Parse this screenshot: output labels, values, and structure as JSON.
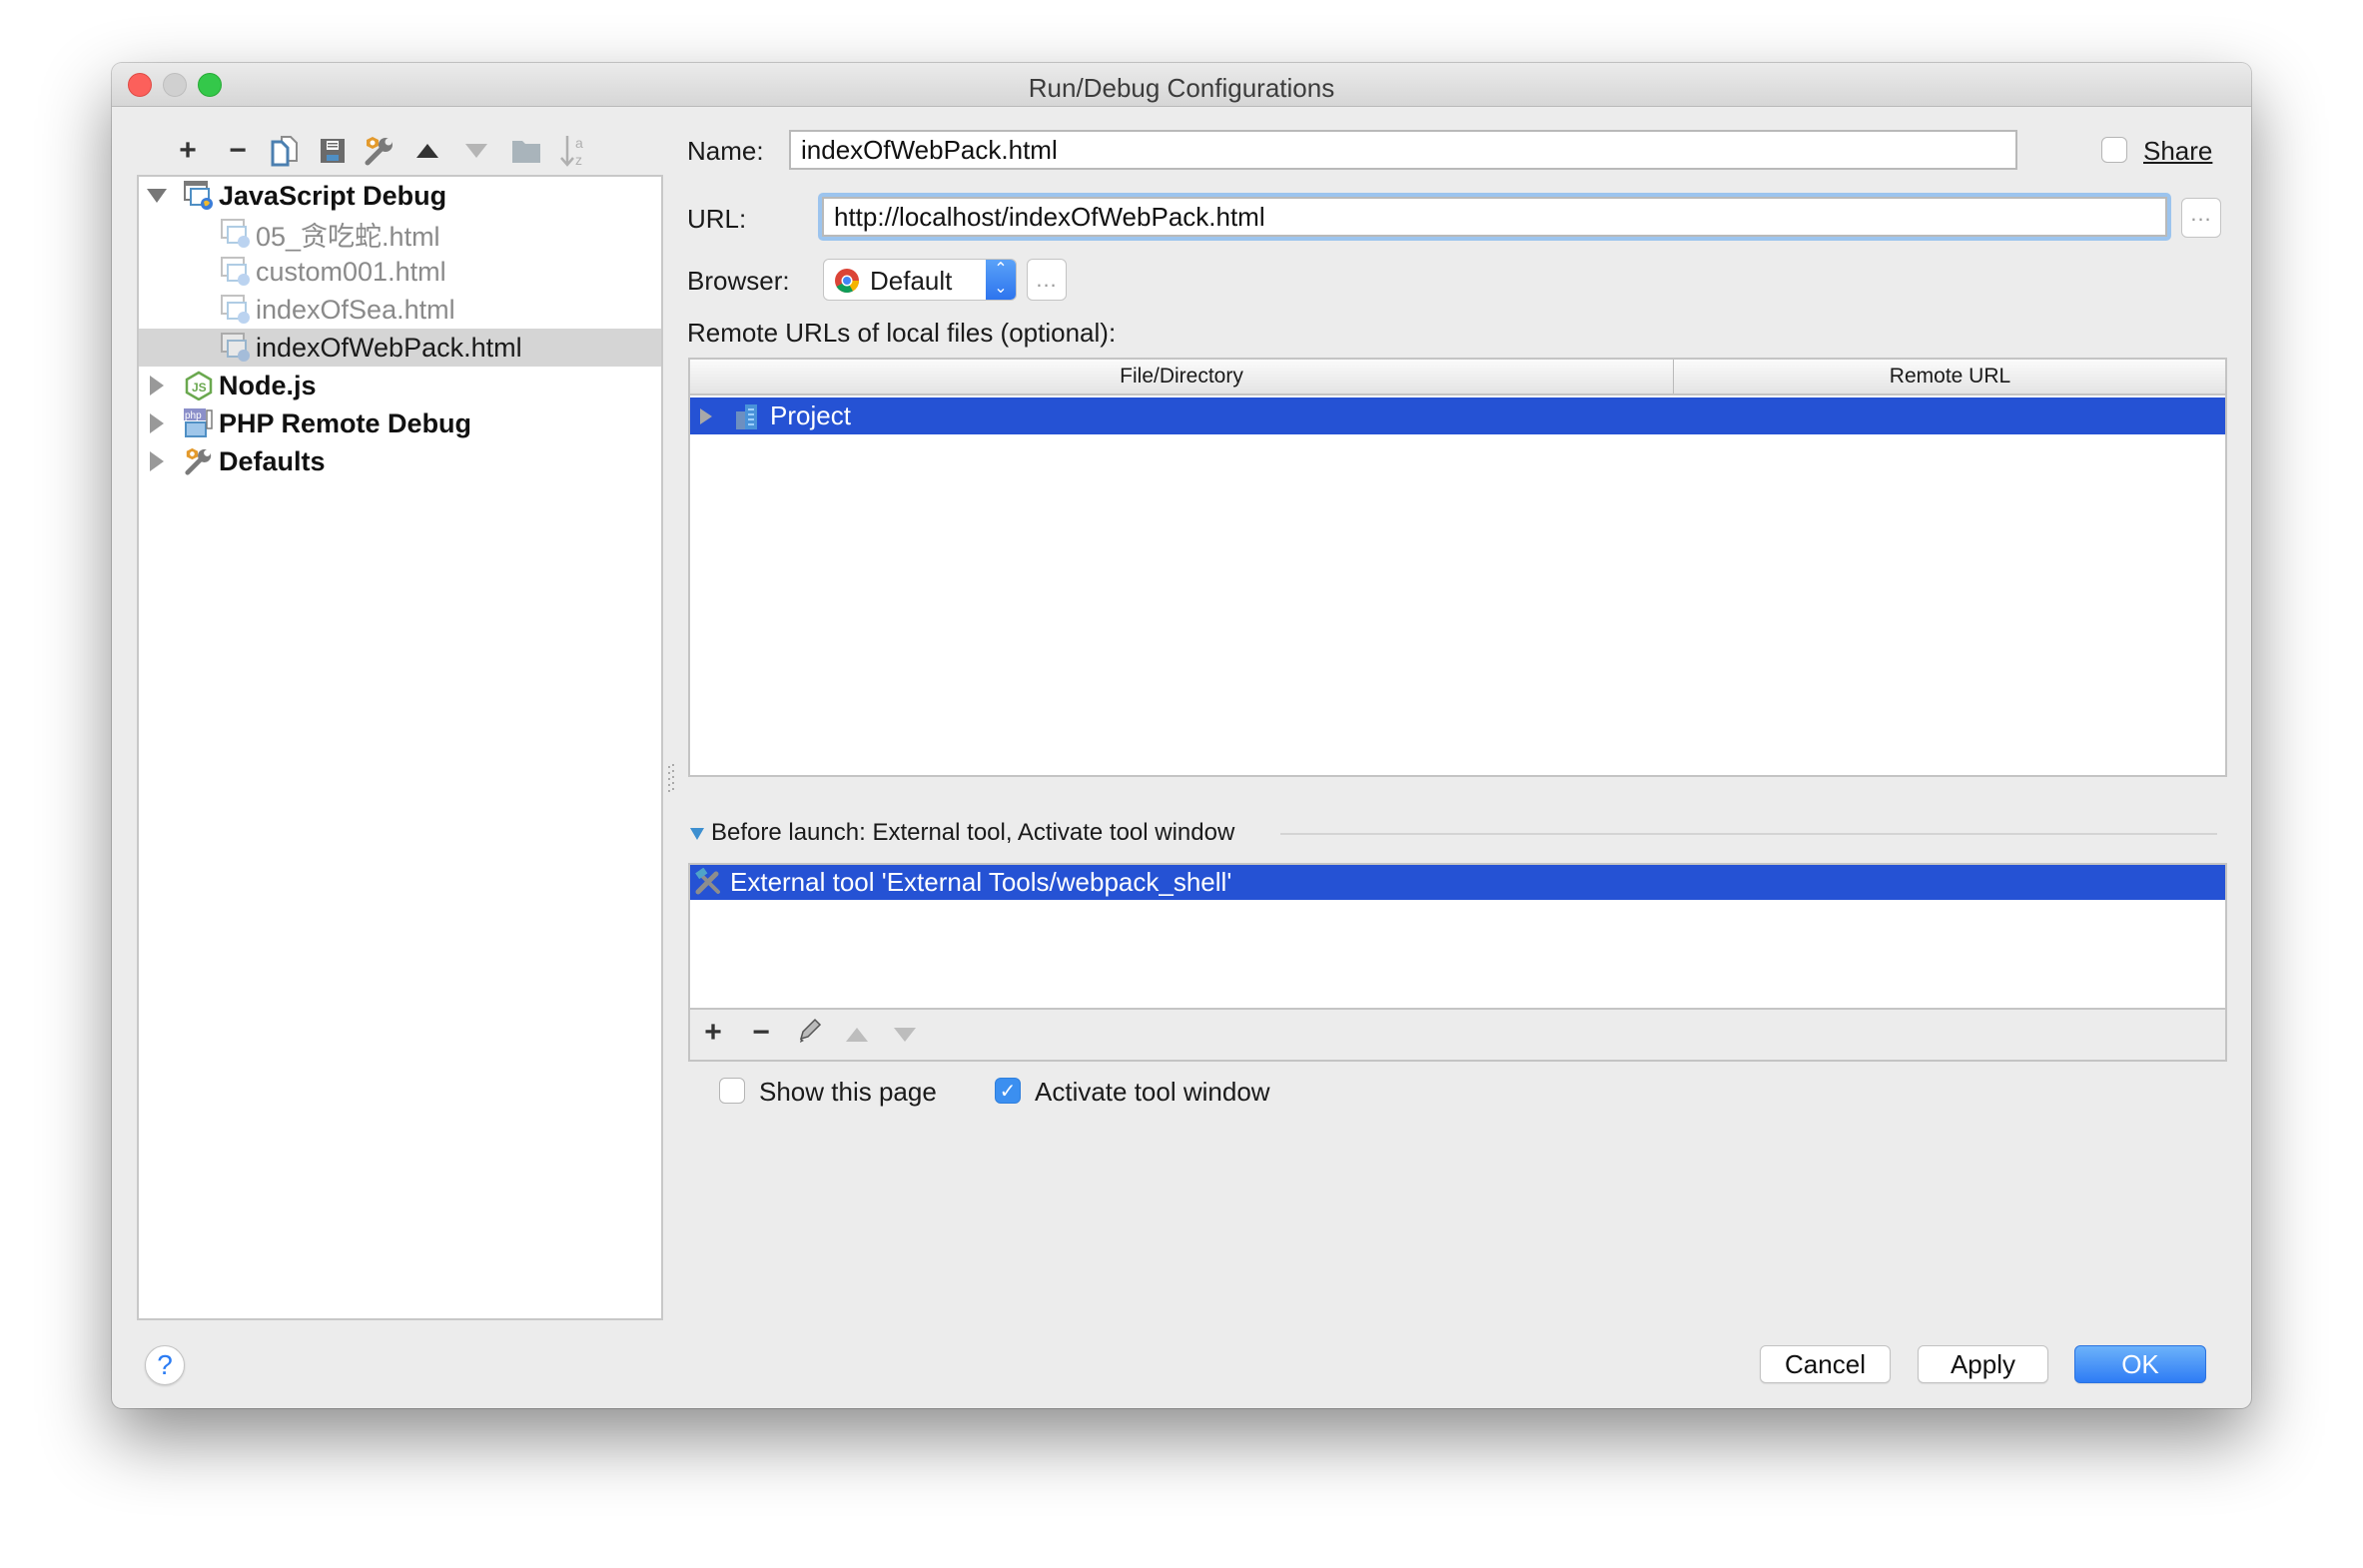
{
  "window": {
    "title": "Run/Debug Configurations"
  },
  "toolbar": {
    "items": [
      {
        "name": "add",
        "icon": "plus-icon"
      },
      {
        "name": "remove",
        "icon": "minus-icon"
      },
      {
        "name": "copy",
        "icon": "copy-icon"
      },
      {
        "name": "save",
        "icon": "save-icon"
      },
      {
        "name": "edit-defaults",
        "icon": "wrench-icon"
      },
      {
        "name": "move-up",
        "icon": "triangle-up-icon"
      },
      {
        "name": "move-down",
        "icon": "triangle-down-icon"
      },
      {
        "name": "folder",
        "icon": "folder-icon"
      },
      {
        "name": "sort",
        "icon": "sort-alpha-icon"
      }
    ]
  },
  "tree": {
    "groups": [
      {
        "label": "JavaScript Debug",
        "expanded": true,
        "icon": "javascript-debug-icon",
        "children": [
          {
            "label": "05_贪吃蛇.html",
            "selected": false
          },
          {
            "label": "custom001.html",
            "selected": false
          },
          {
            "label": "indexOfSea.html",
            "selected": false
          },
          {
            "label": "indexOfWebPack.html",
            "selected": true
          }
        ]
      },
      {
        "label": "Node.js",
        "expanded": false,
        "icon": "nodejs-icon"
      },
      {
        "label": "PHP Remote Debug",
        "expanded": false,
        "icon": "php-remote-debug-icon"
      },
      {
        "label": "Defaults",
        "expanded": false,
        "icon": "defaults-wrench-icon"
      }
    ]
  },
  "form": {
    "name_label": "Name:",
    "name_value": "indexOfWebPack.html",
    "share_label": "Share",
    "share_checked": false,
    "url_label": "URL:",
    "url_value": "http://localhost/indexOfWebPack.html",
    "url_browse": "...",
    "browser_label": "Browser:",
    "browser_value": "Default",
    "browser_more": "...",
    "remote_urls_label": "Remote URLs of local files (optional):"
  },
  "remote_table": {
    "columns": [
      "File/Directory",
      "Remote URL"
    ],
    "rows": [
      {
        "file": "Project",
        "remote_url": "",
        "selected": true
      }
    ]
  },
  "before_launch": {
    "header": "Before launch: External tool, Activate tool window",
    "items": [
      {
        "label": "External tool 'External Tools/webpack_shell'",
        "selected": true
      }
    ],
    "toolbar": [
      "plus-icon",
      "minus-icon",
      "pencil-icon",
      "triangle-up-icon",
      "triangle-down-icon"
    ]
  },
  "options": {
    "show_this_page_label": "Show this page",
    "show_this_page_checked": false,
    "activate_tool_window_label": "Activate tool window",
    "activate_tool_window_checked": true
  },
  "buttons": {
    "help": "?",
    "cancel": "Cancel",
    "apply": "Apply",
    "ok": "OK"
  },
  "colors": {
    "selection": "#2552d4",
    "accent": "#2e7cf5",
    "focus_ring": "#9cc4ee",
    "tree_selection": "#d5d5d5"
  }
}
